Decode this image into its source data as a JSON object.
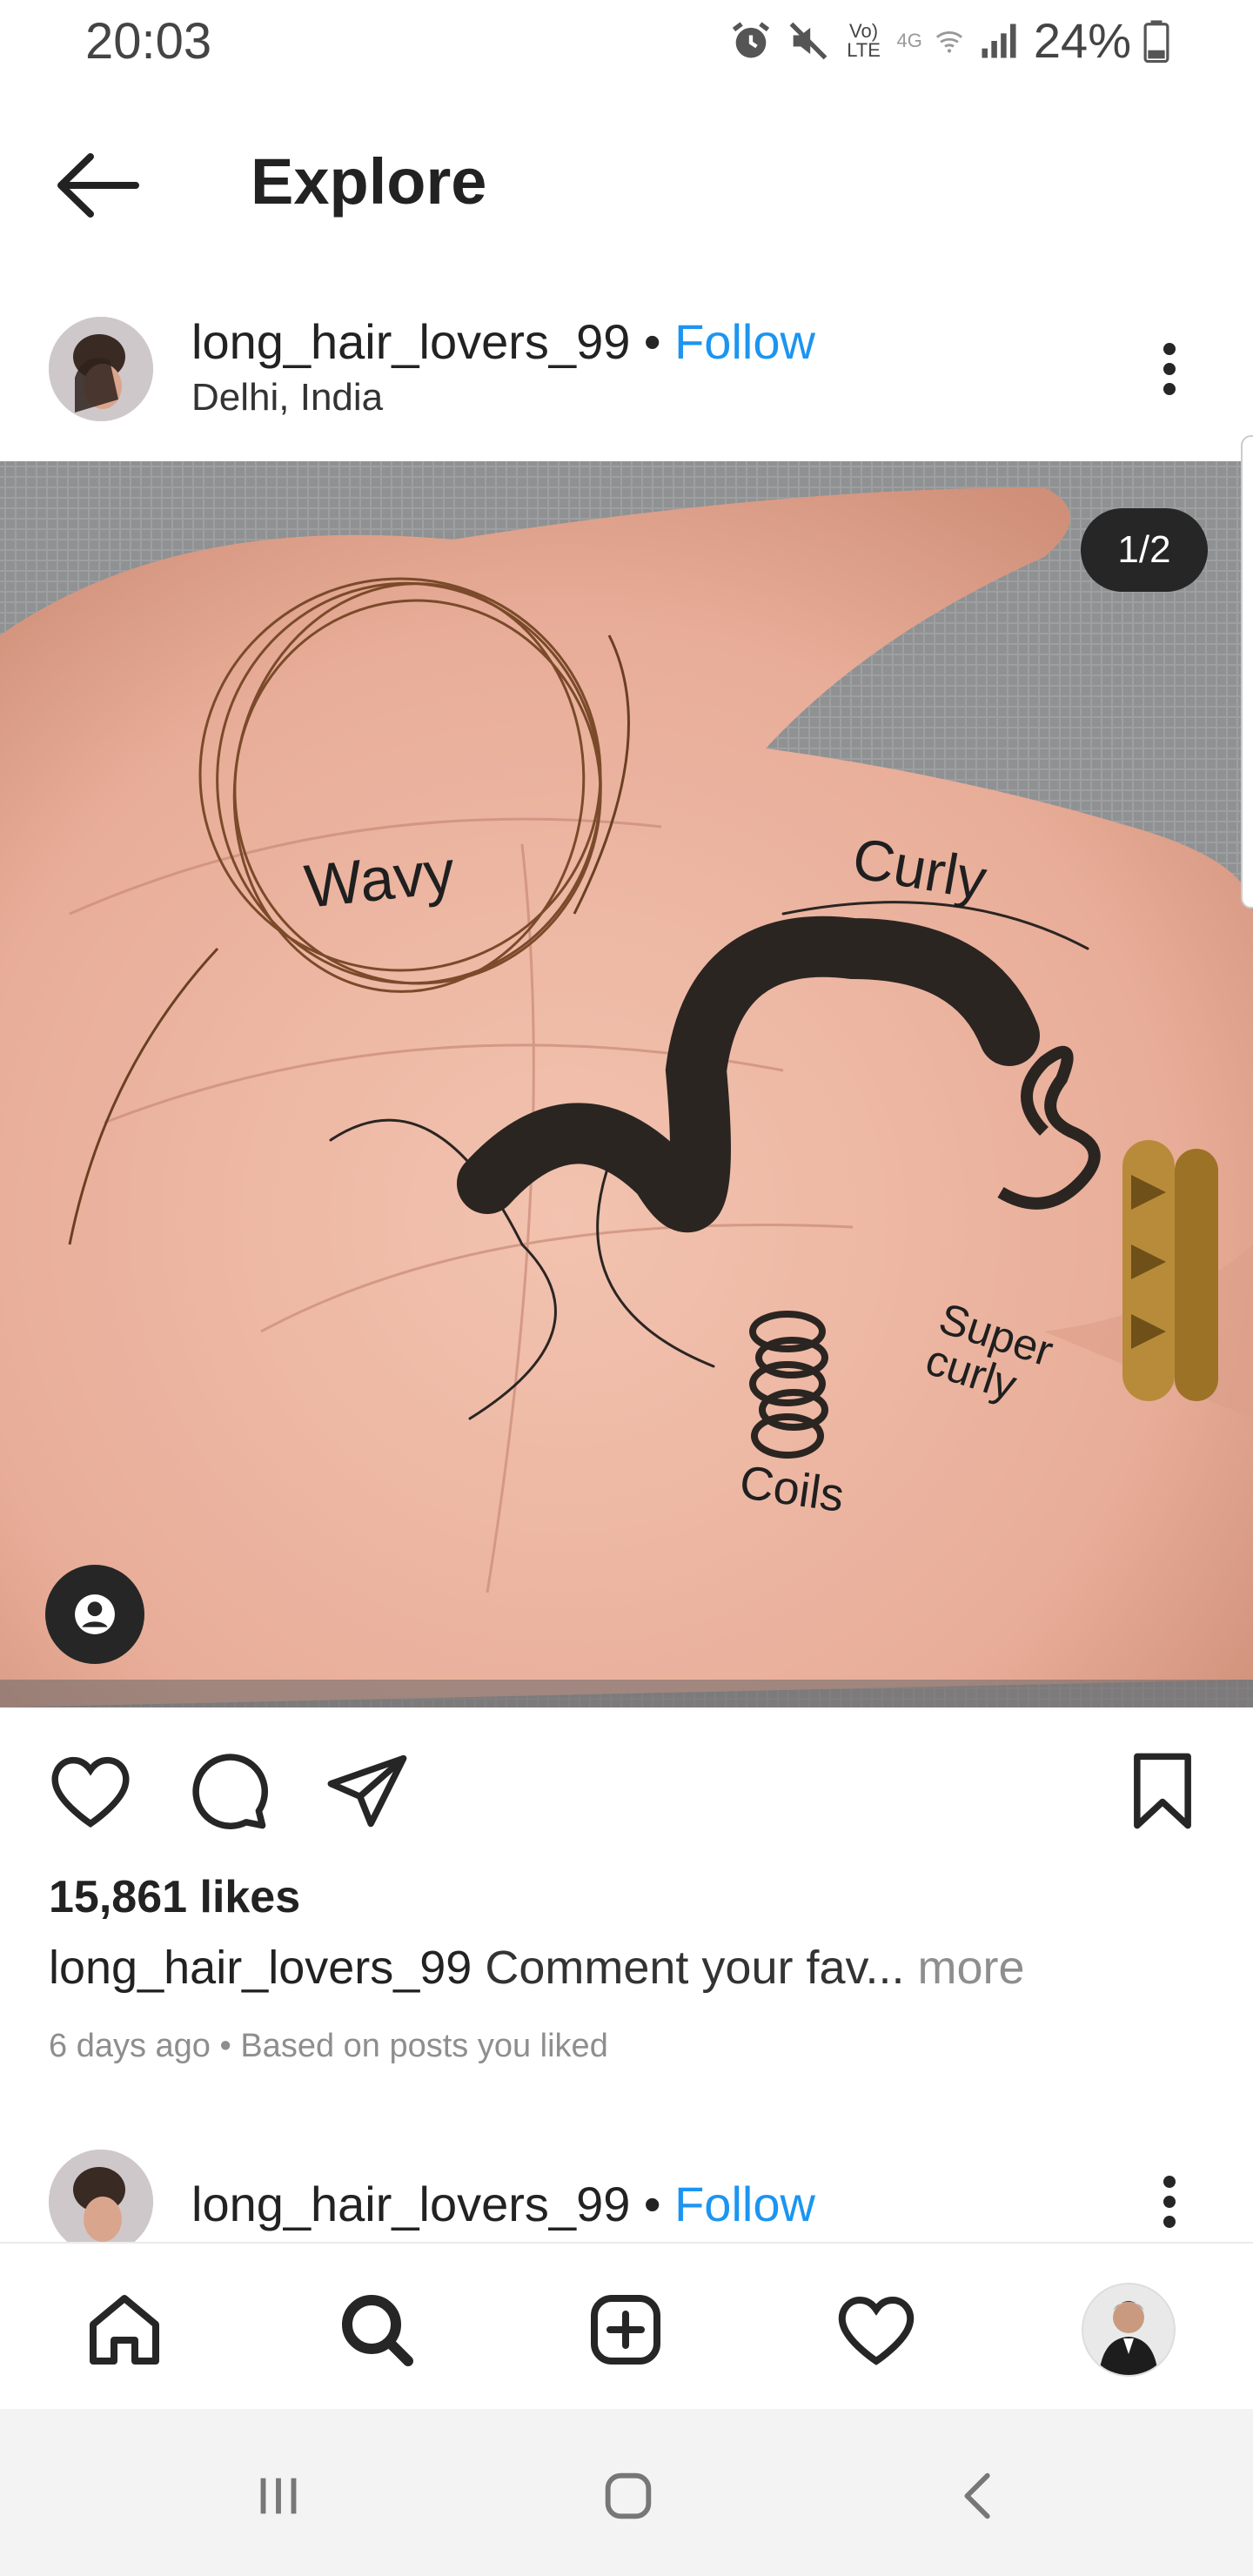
{
  "status_bar": {
    "time": "20:03",
    "battery": "24%",
    "network_label": "Vo) LTE",
    "signal_label": "4G",
    "icons": [
      "alarm-icon",
      "mute-icon",
      "volte-icon",
      "wifi-icon",
      "signal-icon",
      "battery-icon"
    ]
  },
  "header": {
    "title": "Explore",
    "back_icon": "back-arrow-icon"
  },
  "post": {
    "username": "long_hair_lovers_99",
    "separator": "•",
    "follow_label": "Follow",
    "location": "Delhi, India",
    "image_counter": "1/2",
    "image_labels": [
      "Wavy",
      "Curly",
      "Super curly",
      "Coils"
    ],
    "likes": "15,861 likes",
    "caption_user": "long_hair_lovers_99",
    "caption_text": "Comment your fav...",
    "caption_more": "more",
    "meta": "6 days ago • Based on posts you liked"
  },
  "next_post": {
    "username": "long_hair_lovers_99",
    "separator": "•",
    "follow_label": "Follow"
  },
  "tabs": [
    "home-icon",
    "search-icon",
    "add-post-icon",
    "activity-heart-icon",
    "profile-avatar"
  ],
  "system_nav": [
    "recent-apps-icon",
    "home-button-icon",
    "back-icon"
  ],
  "colors": {
    "accent": "#1c95f1",
    "text": "#262626",
    "muted": "#8e8e8e",
    "skin": "#e8b3a0",
    "background": "#ffffff"
  }
}
